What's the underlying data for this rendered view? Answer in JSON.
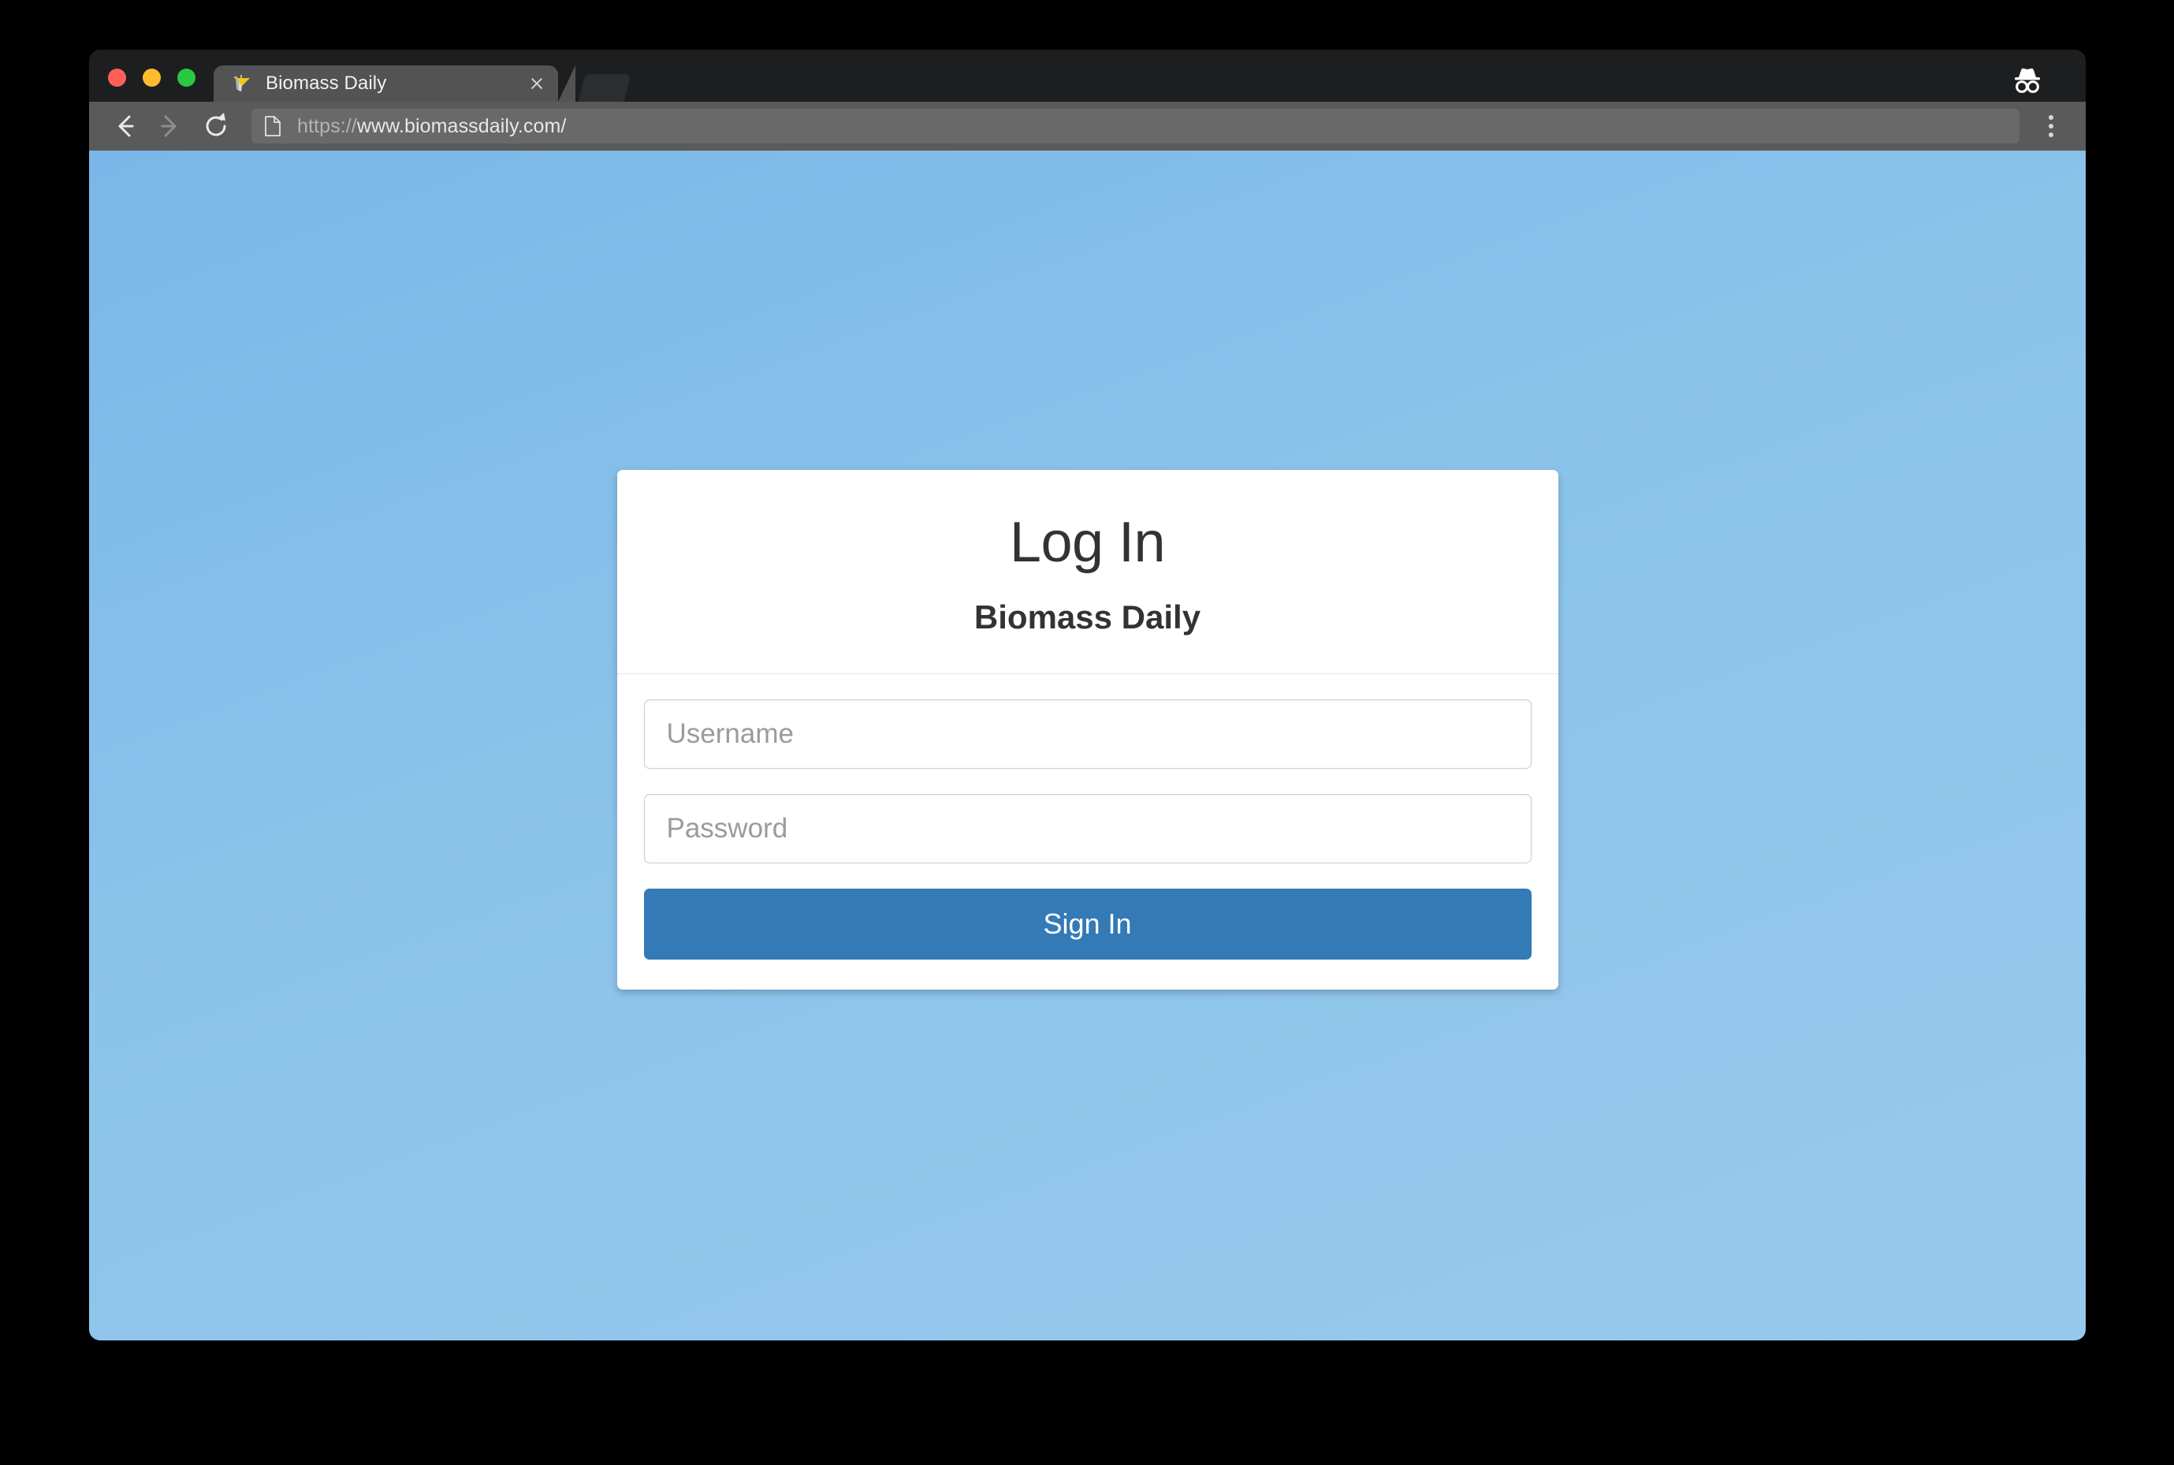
{
  "browser": {
    "traffic_lights": [
      {
        "name": "close",
        "color": "#ff5f57"
      },
      {
        "name": "minimize",
        "color": "#febc2e"
      },
      {
        "name": "maximize",
        "color": "#28c840"
      }
    ],
    "tab": {
      "title": "Biomass Daily",
      "favicon": "biomass-daily-favicon",
      "close_icon": "close-icon"
    },
    "new_tab_button": "new-tab-button",
    "incognito_icon": "incognito-icon",
    "toolbar": {
      "back_icon": "back-arrow-icon",
      "forward_icon": "forward-arrow-icon",
      "reload_icon": "reload-icon",
      "page_info_icon": "page-document-icon",
      "url_scheme": "https://",
      "url_host": "www.biomassdaily.com/",
      "menu_icon": "three-dot-menu-icon"
    }
  },
  "page": {
    "background_top_color": "#7ab7e8",
    "background_bottom_color": "#97c9ed",
    "login": {
      "title": "Log In",
      "subtitle": "Biomass Daily",
      "username": {
        "value": "",
        "placeholder": "Username"
      },
      "password": {
        "value": "",
        "placeholder": "Password"
      },
      "submit_label": "Sign In",
      "submit_color": "#337ab7"
    }
  }
}
